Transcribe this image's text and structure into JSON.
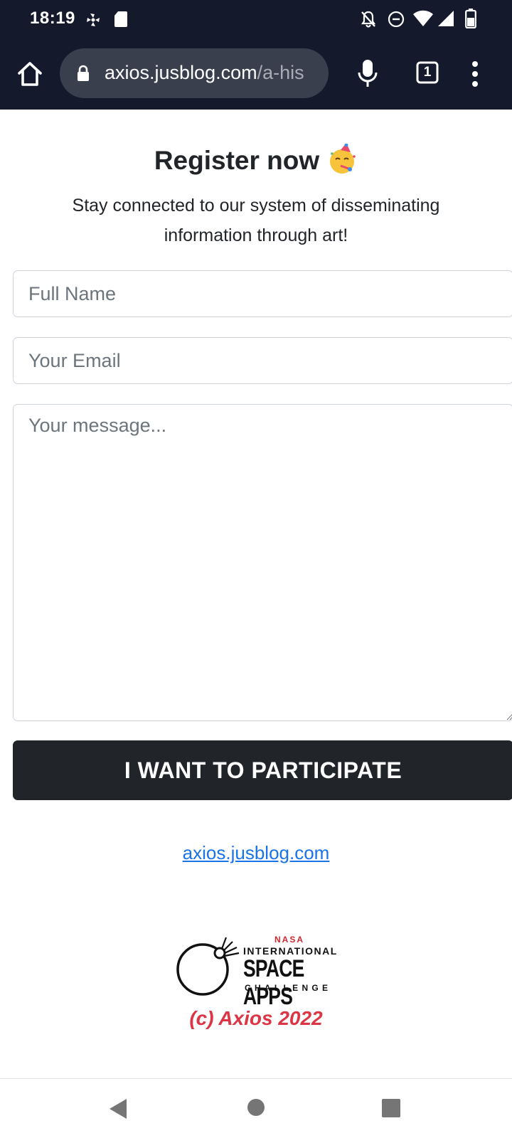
{
  "status_bar": {
    "time": "18:19",
    "left_icons": [
      "fan-icon",
      "sd-card-icon"
    ],
    "right_icons": [
      "bell-off-icon",
      "do-not-disturb-icon",
      "wifi-icon",
      "signal-icon",
      "battery-icon"
    ]
  },
  "browser": {
    "url_domain": "axios.jusblog.com",
    "url_path": "/a-his",
    "tab_count": "1"
  },
  "page": {
    "title": "Register now",
    "subtitle": "Stay connected to our system of disseminating information through art!",
    "form": {
      "name_placeholder": "Full Name",
      "email_placeholder": "Your Email",
      "message_placeholder": "Your message...",
      "submit_label": "I WANT TO PARTICIPATE"
    },
    "site_link": "axios.jusblog.com",
    "logo": {
      "nasa": "NASA",
      "international": "INTERNATIONAL",
      "space_apps": "SPACE APPS",
      "challenge": "CHALLENGE"
    },
    "copyright": "(c)  Axios 2022"
  },
  "colors": {
    "toolbar_bg": "#141a2b",
    "button_bg": "#212529",
    "link": "#1a73e8",
    "copyright": "#dc3545",
    "nasa_red": "#d22630"
  }
}
